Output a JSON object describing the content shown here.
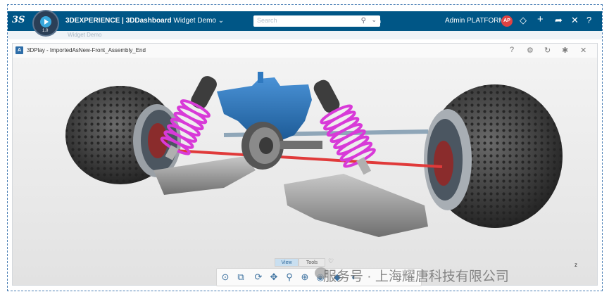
{
  "topbar": {
    "logo": "3S",
    "compass_version": "1.0",
    "brand_bold": "3DEXPERIENCE | 3DDashboard",
    "brand_rest": " Widget Demo",
    "brand_caret": "⌄",
    "search_placeholder": "Search",
    "username": "Admin PLATFORM",
    "avatar_initials": "AP"
  },
  "tabs": {
    "label": "Widget Demo"
  },
  "widget": {
    "icon_letter": "A",
    "title": "3DPlay - ImportedAsNew-Front_Assembly_End"
  },
  "viewport": {
    "triad_label": "z"
  },
  "toolbar": {
    "tabs": [
      {
        "label": "View",
        "active": true
      },
      {
        "label": "Tools",
        "active": false
      }
    ]
  },
  "watermark": {
    "text": "服务号 · 上海耀唐科技有限公司"
  },
  "colors": {
    "topbar": "#005686",
    "spring": "#d83ad8",
    "frame": "#2e7bc4",
    "tire": "#3a3a3a",
    "rod": "#e03a3a"
  }
}
